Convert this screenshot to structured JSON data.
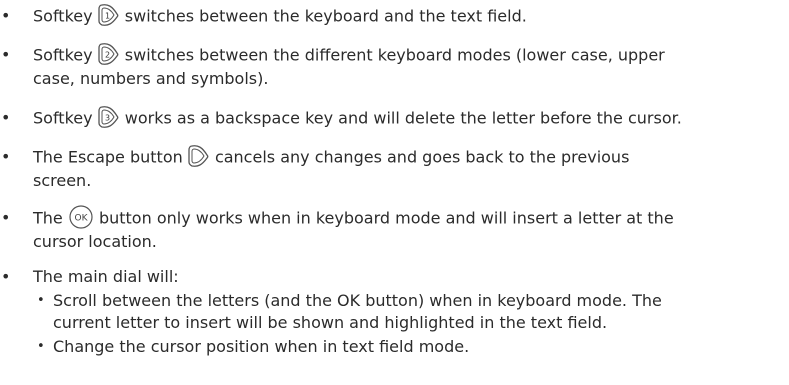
{
  "bullets": [
    {
      "before": "Softkey",
      "icon": "softkey-1-icon",
      "after": "switches between the keyboard and the text field."
    },
    {
      "before": "Softkey",
      "icon": "softkey-2-icon",
      "after": "switches between the different keyboard modes (lower case, upper",
      "line2": "case, numbers and symbols)."
    },
    {
      "before": "Softkey",
      "icon": "softkey-3-icon",
      "after": "works as a backspace key and will delete the letter before the cursor."
    },
    {
      "before": "The Escape button",
      "icon": "escape-button-icon",
      "after": "cancels any changes and goes back to the previous",
      "line2": "screen."
    },
    {
      "before": "The",
      "icon": "ok-button-icon",
      "icon_label": "OK",
      "after": "button only works when in keyboard mode and will insert a letter at the",
      "line2": "cursor location."
    },
    {
      "text": "The main dial will:"
    }
  ],
  "sub_bullets": [
    {
      "line1": "Scroll between the letters (and the OK button) when in keyboard mode. The",
      "line2": "current letter to insert will be shown and highlighted in the text field."
    },
    {
      "line1": "Change the cursor position when in text field mode."
    }
  ],
  "bullet_char": "•"
}
